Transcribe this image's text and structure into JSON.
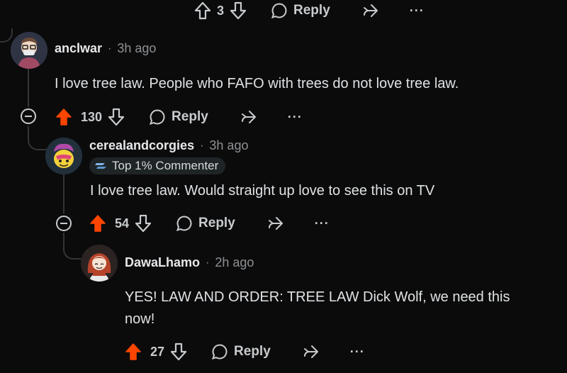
{
  "top_bar": {
    "vote_count": "3",
    "reply_label": "Reply",
    "more_label": "···"
  },
  "comments": [
    {
      "author": "anclwar",
      "time": "3h ago",
      "text": "I love tree law. People who FAFO with trees do not love tree law.",
      "vote_count": "130",
      "reply_label": "Reply",
      "more_label": "···"
    },
    {
      "author": "cerealandcorgies",
      "time": "3h ago",
      "badge": "Top 1% Commenter",
      "text": "I love tree law. Would straight up love to see this on TV",
      "vote_count": "54",
      "reply_label": "Reply",
      "more_label": "···"
    },
    {
      "author": "DawaLhamo",
      "time": "2h ago",
      "text_line1": "YES! LAW AND ORDER: TREE LAW Dick Wolf, we need this",
      "text_line2": "now!",
      "vote_count": "27",
      "reply_label": "Reply",
      "more_label": "···"
    }
  ],
  "meta_separator": "·",
  "colors": {
    "background": "#0b0b0c",
    "upvote_active": "#ff4500",
    "thread_line": "#343536",
    "text": "#d7dadc",
    "muted": "#8e9193"
  },
  "icons": {
    "upvote": "arrow-up-icon",
    "downvote": "arrow-down-icon",
    "reply": "speech-bubble-icon",
    "share": "share-icon",
    "more": "ellipsis-icon",
    "collapse": "minus-circle-icon",
    "badge": "top-commenter-icon"
  }
}
